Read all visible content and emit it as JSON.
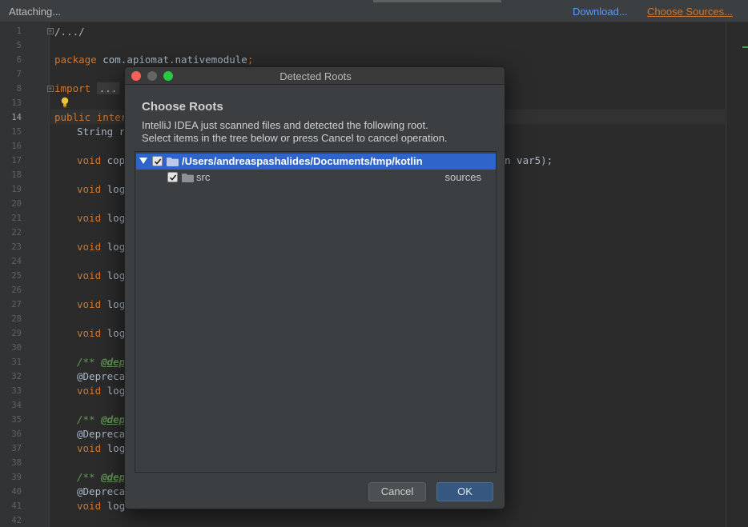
{
  "topbar": {
    "status": "Attaching...",
    "download_link": "Download...",
    "choose_sources_link": "Choose Sources..."
  },
  "editor": {
    "line_numbers": [
      "1",
      "5",
      "6",
      "7",
      "8",
      "13",
      "14",
      "15",
      "16",
      "17",
      "18",
      "19",
      "20",
      "21",
      "22",
      "23",
      "24",
      "25",
      "26",
      "27",
      "28",
      "29",
      "30",
      "31",
      "32",
      "33",
      "34",
      "35",
      "36",
      "37",
      "38",
      "39",
      "40",
      "41",
      "42"
    ],
    "active_line": "14",
    "lines": {
      "l1": "/.../",
      "l6_kw": "package",
      "l6_rest": " com.apiomat.nativemodule",
      "l6_end": ";",
      "l8_kw": "import",
      "l8_fold": "...",
      "l14_kw": "public inter",
      "l15": "String re",
      "l17_void": "void",
      "l17_rest": " copy",
      "l17_tail": "n var5);",
      "l19": "log",
      "l21": "logl",
      "l23": "logl",
      "l25": "logl",
      "l27": "logl",
      "l29": "logl",
      "l31_doc": "/** ",
      "l31_tag": "@depr",
      "l32": "@Deprecat",
      "l33": "log",
      "l35_doc": "/** ",
      "l35_tag": "@depr",
      "l36": "@Deprecat",
      "l37": "logl",
      "l39_doc": "/** ",
      "l39_tag": "@depr",
      "l40": "@Deprecat",
      "l41": "logl",
      "void_kw": "void"
    }
  },
  "dialog": {
    "title": "Detected Roots",
    "heading": "Choose Roots",
    "description_line1": "IntelliJ IDEA just scanned files and detected the following root.",
    "description_line2": "Select items in the tree below or press Cancel to cancel operation.",
    "tree": {
      "root": {
        "label": "/Users/andreaspashalides/Documents/tmp/kotlin",
        "checked": true,
        "expanded": true
      },
      "children": [
        {
          "label": "src",
          "type": "sources",
          "checked": true
        }
      ]
    },
    "cancel_label": "Cancel",
    "ok_label": "OK"
  },
  "colors": {
    "selection": "#2f65ca",
    "keyword": "#cc7832",
    "link": "#589df6",
    "doc_comment": "#629755",
    "annotation": "#bbb529"
  }
}
